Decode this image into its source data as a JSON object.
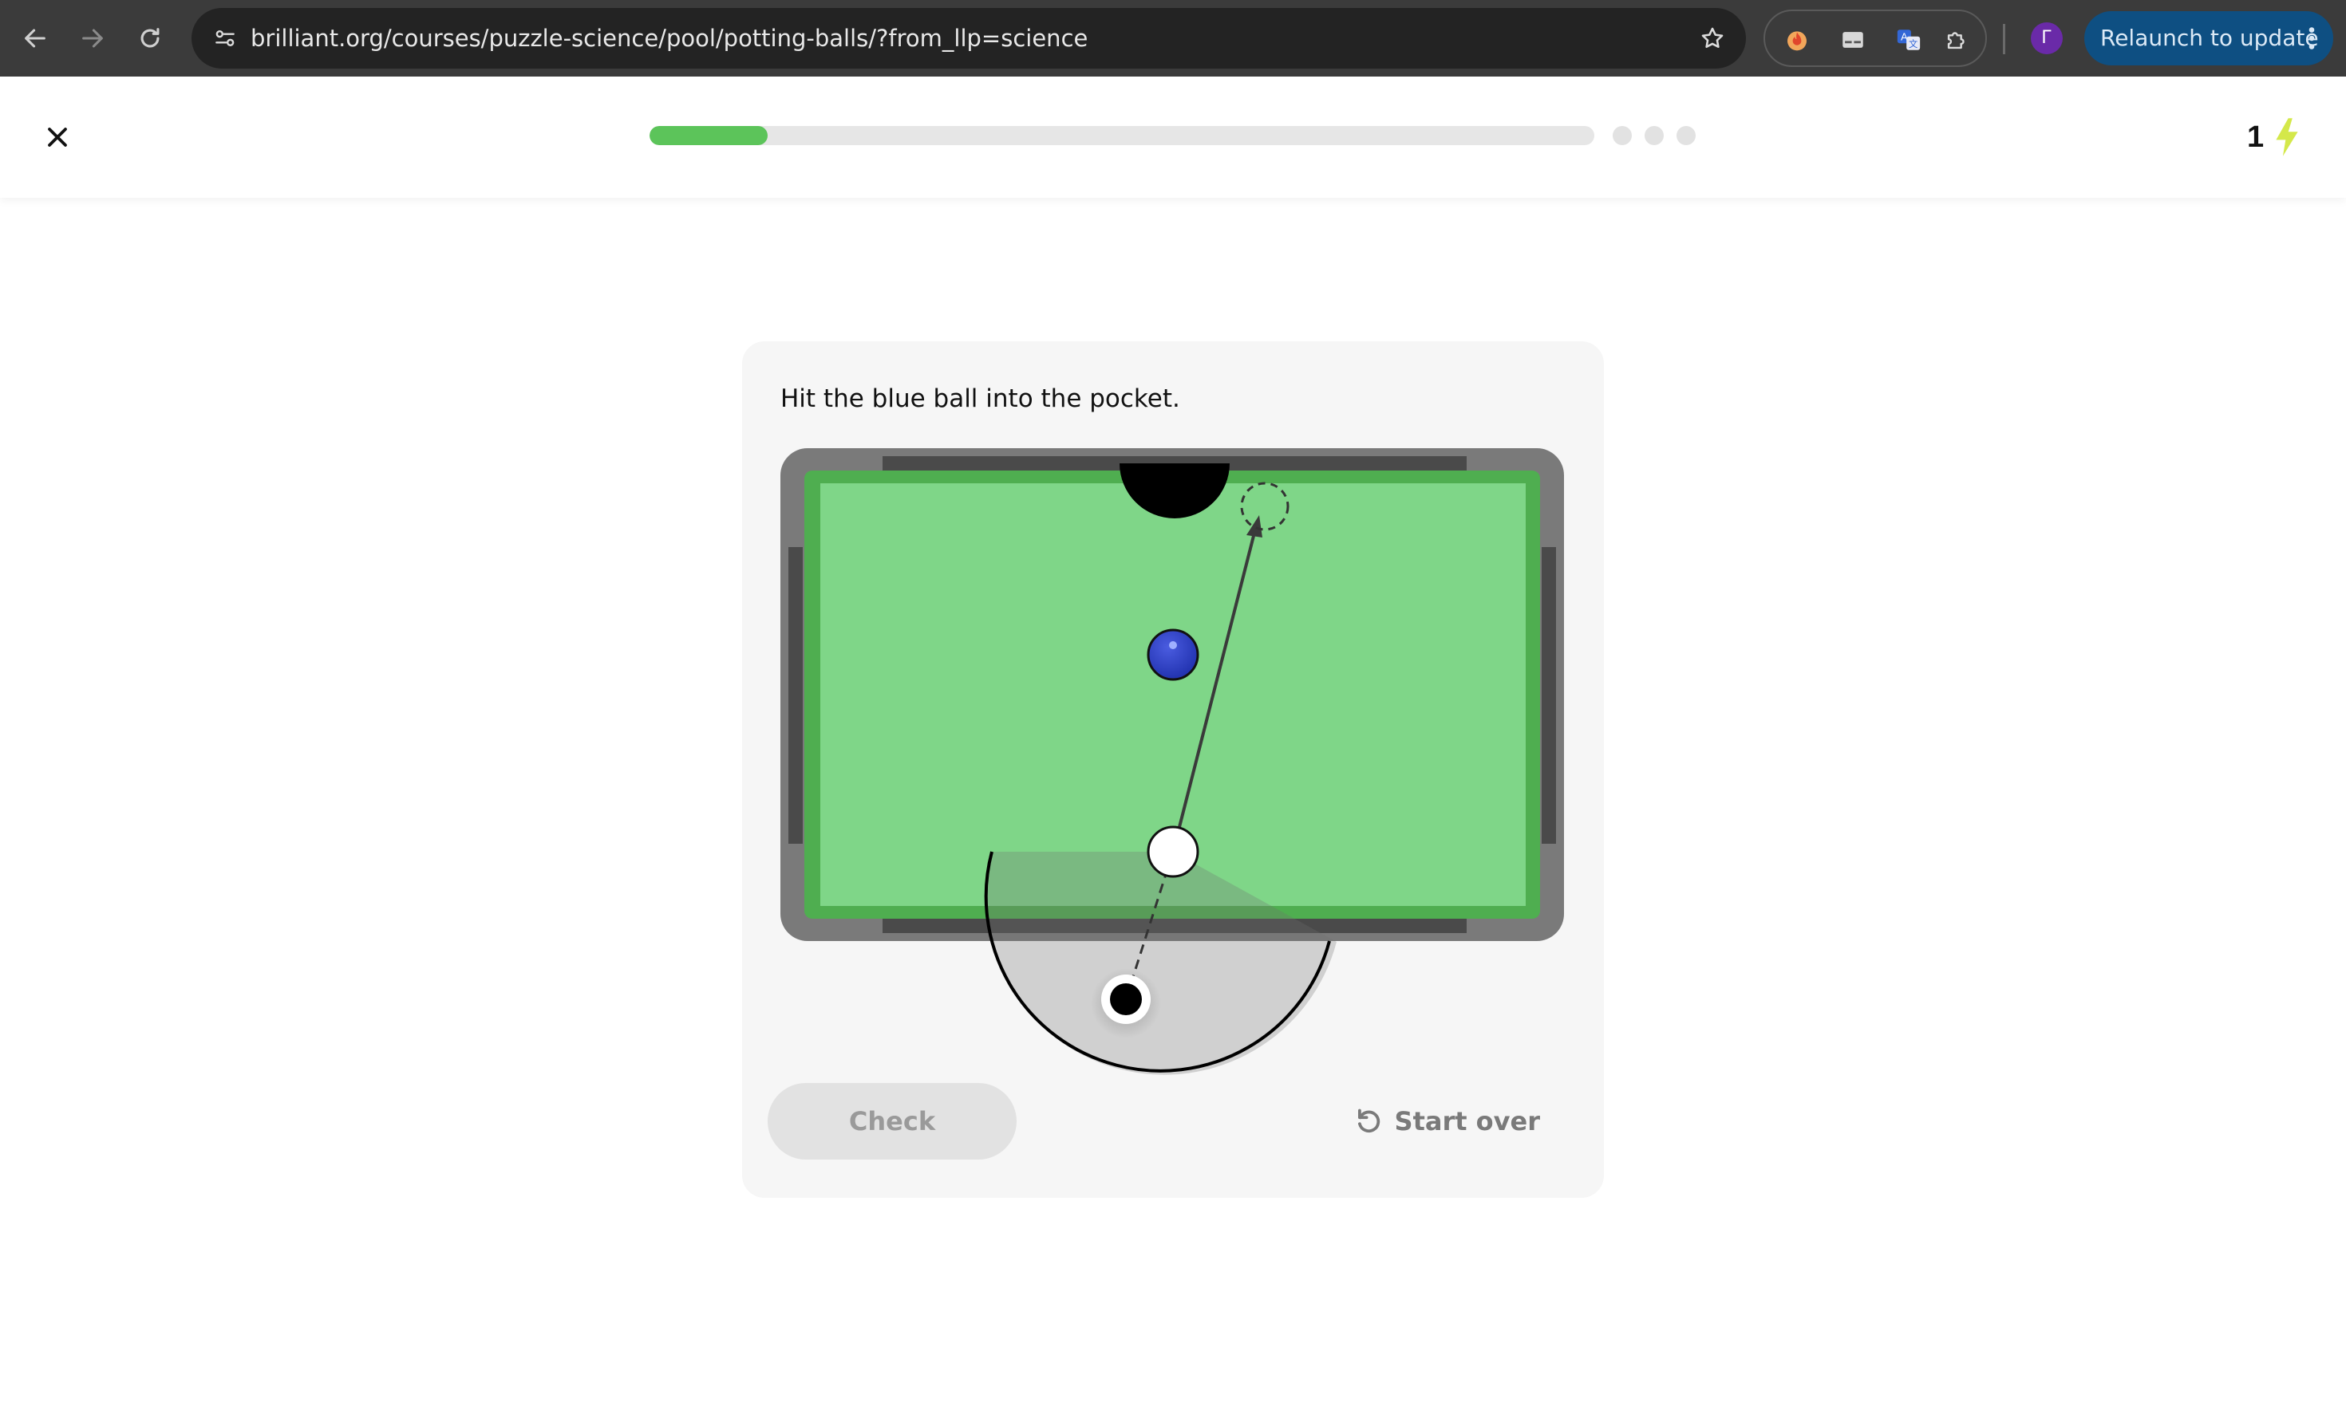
{
  "browser": {
    "url": "brilliant.org/courses/puzzle-science/pool/potting-balls/?from_llp=science",
    "profile_initial": "Г",
    "relaunch_label": "Relaunch to update",
    "icons": [
      "back-arrow-icon",
      "forward-arrow-icon",
      "reload-icon",
      "site-info-icon",
      "bookmark-star-icon",
      "flame-extension-icon",
      "subtitles-extension-icon",
      "translate-extension-icon",
      "puzzle-extensions-icon",
      "more-vert-icon"
    ]
  },
  "lesson": {
    "progress_fraction": 0.125,
    "remaining_steps": 3,
    "energy_count": "1",
    "close_icon": "close-icon",
    "energy_icon": "lightning-bolt-icon"
  },
  "puzzle": {
    "prompt": "Hit the blue ball into the pocket.",
    "check_label": "Check",
    "start_over_label": "Start over",
    "start_over_icon": "restart-icon"
  },
  "colors": {
    "felt": "#7fd688",
    "felt_edge": "#4caf50",
    "rail": "#7a7a7a",
    "cushion": "#4a4a4a",
    "target_ball": "#2d3fc4",
    "progress": "#5cc45a",
    "energy": "#d4e84a",
    "relaunch": "#0e4f82"
  }
}
